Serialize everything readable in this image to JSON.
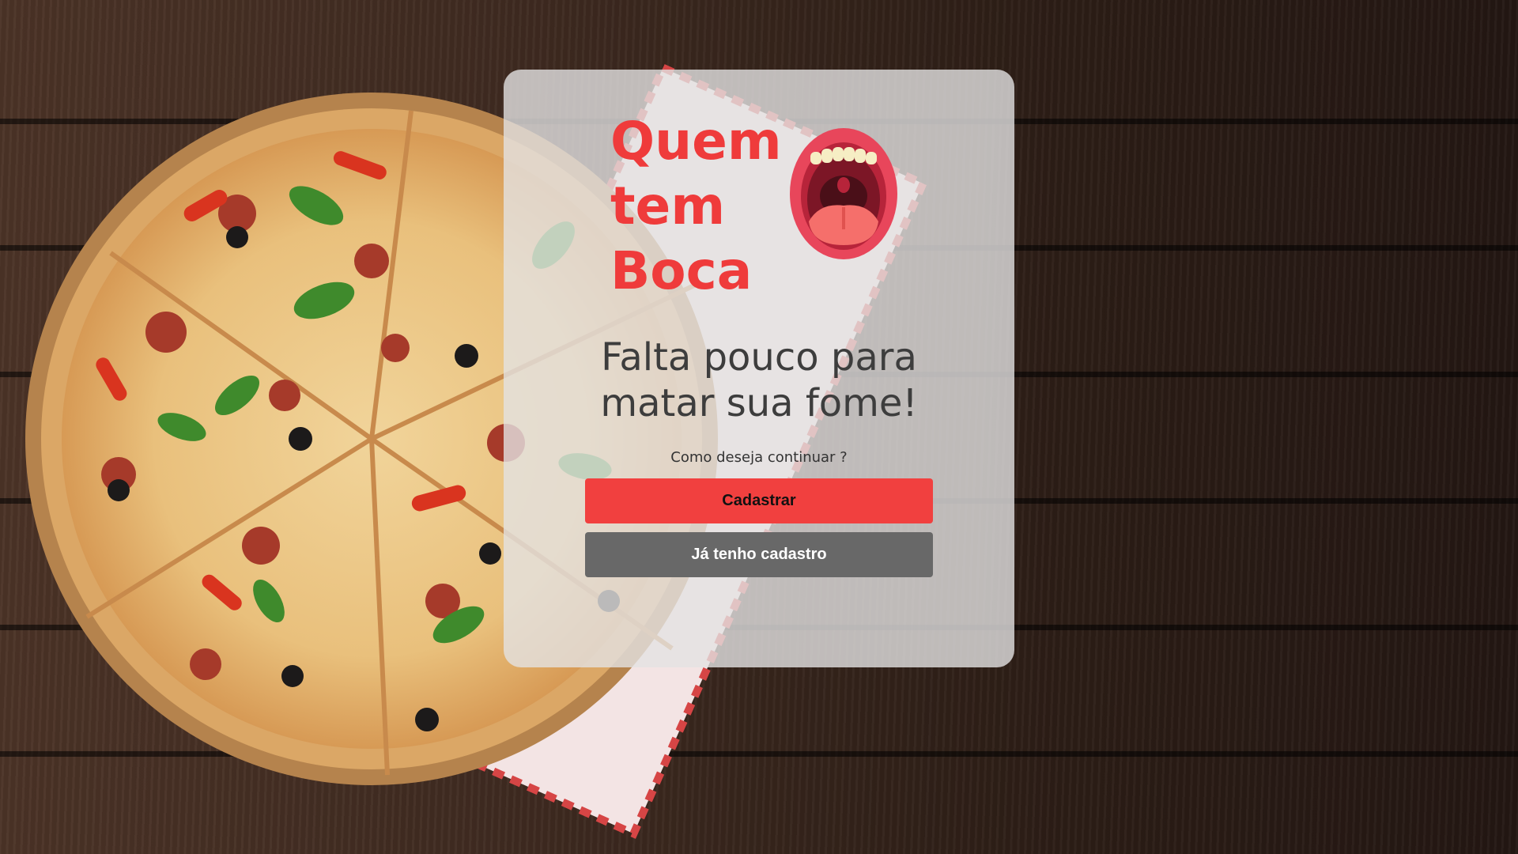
{
  "brand": {
    "logo_lines": [
      "Quem",
      "tem",
      "Boca"
    ],
    "color": "#ef3b3b",
    "icon": "open-mouth-icon"
  },
  "headline": {
    "lines": [
      "Falta pouco para",
      "matar sua fome!"
    ]
  },
  "prompt": "Como deseja continuar ?",
  "buttons": {
    "register_label": "Cadastrar",
    "login_label": "Já tenho cadastro"
  },
  "colors": {
    "primary": "#f1403f",
    "secondary": "#686868"
  }
}
